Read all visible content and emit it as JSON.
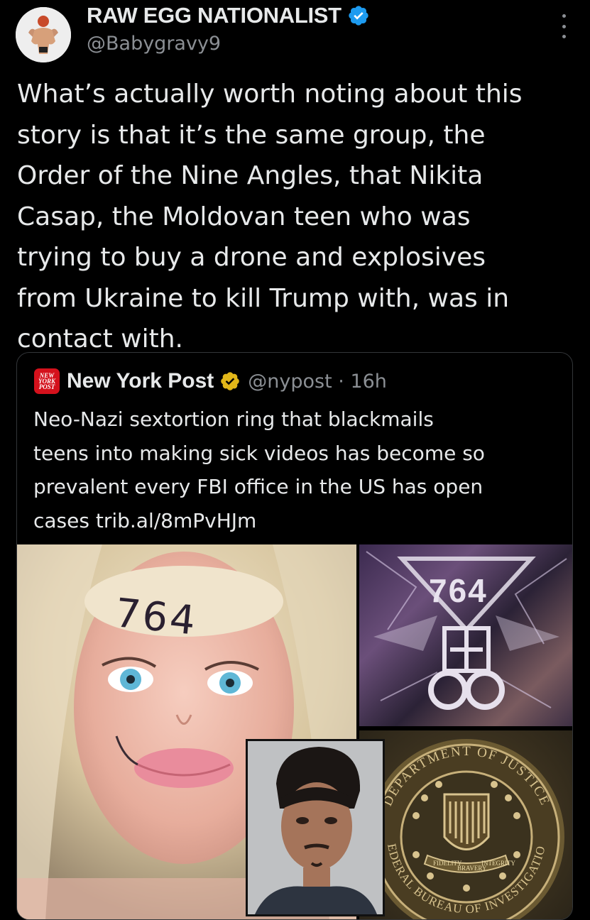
{
  "tweet": {
    "author_name": "RAW EGG NATIONALIST",
    "author_handle": "@Babygravy9",
    "text": "What’s actually worth noting about this\nstory is that it’s the same group, the\nOrder of the Nine Angles, that Nikita\nCasap, the Moldovan teen who was\ntrying to buy a drone and explosives\nfrom Ukraine to kill Trump with, was in\ncontact with.",
    "verified_icon": "blue-verified-badge",
    "more_icon": "more-vertical-icon"
  },
  "quote": {
    "logo_text": "NEW YORK POST",
    "author_name": "New York Post",
    "verified_icon": "gold-verified-badge",
    "meta": "@nypost · 16h",
    "text": "Neo-Nazi sextortion ring that blackmails\nteens into making sick videos has become so\nprevalent every FBI office in the US has open\ncases trib.al/8mPvHJm",
    "images": {
      "barbie_writing": "764",
      "occult_text": "764",
      "seal_ring_top": "DEPARTMENT OF JUSTICE",
      "seal_ring_bottom": "FEDERAL BUREAU OF INVESTIGATION",
      "seal_banner_left": "FIDELITY",
      "seal_banner_mid": "BRAVERY",
      "seal_banner_right": "INTEGRITY"
    }
  },
  "colors": {
    "background": "#000000",
    "text": "#e7e9ea",
    "secondary": "#8b8f94",
    "verified_blue": "#1d9bf0",
    "verified_gold": "#e2b719",
    "nyp_red": "#d4111c"
  }
}
